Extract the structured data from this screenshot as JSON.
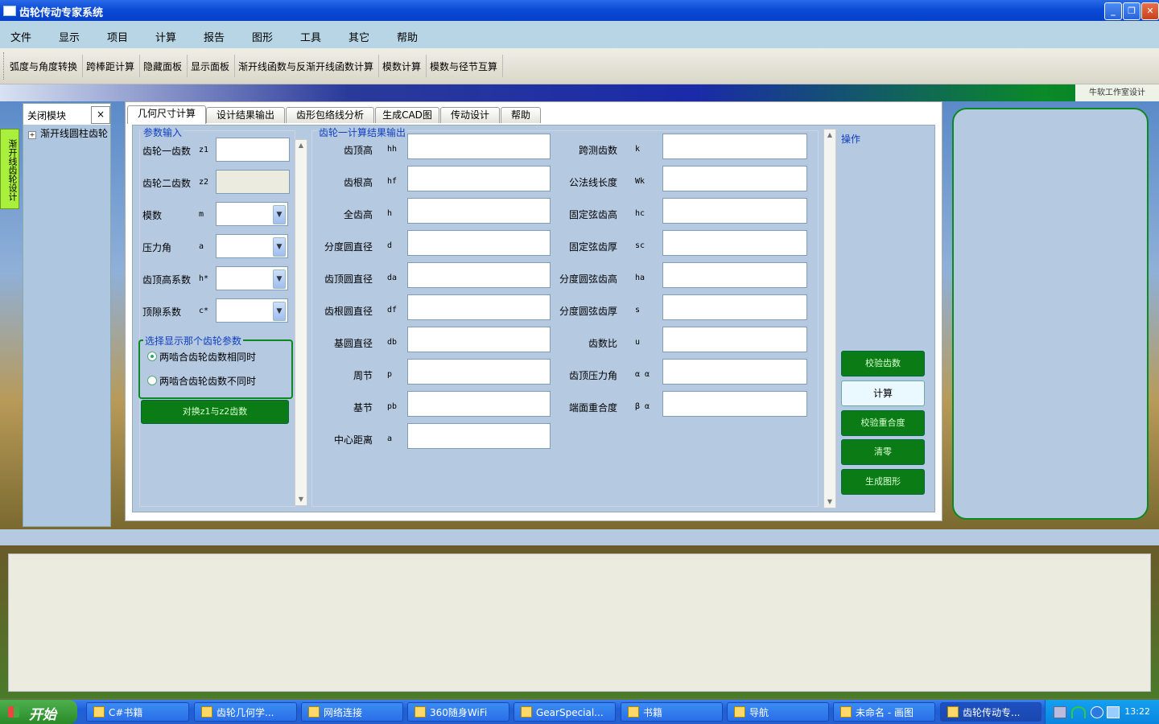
{
  "window": {
    "title": "齿轮传动专家系统",
    "buttons": {
      "minimize": "_",
      "maximize": "❐",
      "close": "✕"
    }
  },
  "menu": [
    "文件",
    "显示",
    "项目",
    "计算",
    "报告",
    "图形",
    "工具",
    "其它",
    "帮助"
  ],
  "toolbar": [
    "弧度与角度转换",
    "跨棒距计算",
    "隐藏面板",
    "显示面板",
    "渐开线函数与反渐开线函数计算",
    "模数计算",
    "模数与径节互算"
  ],
  "banner": {
    "credit": "牛软工作室设计"
  },
  "left_vtab": "渐开线齿轮设计",
  "side_panel": {
    "title": "关闭模块",
    "close": "×",
    "tree_items": [
      {
        "expander": "+",
        "label": "渐开线圆柱齿轮"
      }
    ]
  },
  "tabs": [
    "几何尺寸计算",
    "设计结果输出",
    "齿形包络线分析",
    "生成CAD图",
    "传动设计",
    "帮助"
  ],
  "param_panel": {
    "title": "参数输入",
    "fields": [
      {
        "label": "齿轮一齿数",
        "symbol": "z1",
        "type": "text",
        "value": ""
      },
      {
        "label": "齿轮二齿数",
        "symbol": "z2",
        "type": "disabled",
        "value": ""
      },
      {
        "label": "模数",
        "symbol": "m",
        "type": "combo",
        "value": ""
      },
      {
        "label": "压力角",
        "symbol": "a",
        "type": "combo",
        "value": ""
      },
      {
        "label": "齿顶高系数",
        "symbol": "h*",
        "type": "combo",
        "value": ""
      },
      {
        "label": "顶隙系数",
        "symbol": "c*",
        "type": "combo",
        "value": ""
      }
    ],
    "radio_group": {
      "title": "选择显示那个齿轮参数",
      "options": [
        {
          "label": "两啮合齿轮齿数相同时",
          "checked": true
        },
        {
          "label": "两啮合齿轮齿数不同时",
          "checked": false
        }
      ]
    },
    "swap_button": "对换z1与z2齿数"
  },
  "result_panel": {
    "title": "齿轮一计算结果输出",
    "left_fields": [
      {
        "label": "齿顶高",
        "symbol": "hh",
        "value": ""
      },
      {
        "label": "齿根高",
        "symbol": "hf",
        "value": ""
      },
      {
        "label": "全齿高",
        "symbol": "h",
        "value": ""
      },
      {
        "label": "分度圆直径",
        "symbol": "d",
        "value": ""
      },
      {
        "label": "齿顶圆直径",
        "symbol": "da",
        "value": ""
      },
      {
        "label": "齿根圆直径",
        "symbol": "df",
        "value": ""
      },
      {
        "label": "基圆直径",
        "symbol": "db",
        "value": ""
      },
      {
        "label": "周节",
        "symbol": "p",
        "value": ""
      },
      {
        "label": "基节",
        "symbol": "pb",
        "value": ""
      },
      {
        "label": "中心距离",
        "symbol": "a",
        "value": ""
      }
    ],
    "right_fields": [
      {
        "label": "跨测齿数",
        "symbol": "k",
        "value": ""
      },
      {
        "label": "公法线长度",
        "symbol": "Wk",
        "value": ""
      },
      {
        "label": "固定弦齿高",
        "symbol": "hc",
        "value": ""
      },
      {
        "label": "固定弦齿厚",
        "symbol": "sc",
        "value": ""
      },
      {
        "label": "分度圆弦齿高",
        "symbol": "ha",
        "value": ""
      },
      {
        "label": "分度圆弦齿厚",
        "symbol": "s",
        "value": ""
      },
      {
        "label": "齿数比",
        "symbol": "u",
        "value": ""
      },
      {
        "label": "齿顶压力角",
        "symbol": "α α",
        "value": ""
      },
      {
        "label": "端面重合度",
        "symbol": "β α",
        "value": ""
      }
    ]
  },
  "ops_panel": {
    "title": "操作",
    "buttons": [
      {
        "label": "校验齿数",
        "style": "green"
      },
      {
        "label": "计算",
        "style": "light"
      },
      {
        "label": "校验重合度",
        "style": "green"
      },
      {
        "label": "清零",
        "style": "green"
      },
      {
        "label": "生成图形",
        "style": "green"
      }
    ]
  },
  "scroll_arrows": {
    "up": "▲",
    "down": "▼",
    "combo": "▼"
  },
  "taskbar": {
    "start": "开始",
    "tasks": [
      "C#书籍",
      "齿轮几何学...",
      "网络连接",
      "360随身WiFi",
      "GearSpecial...",
      "书籍",
      "导航",
      "未命名 - 画图",
      "齿轮传动专..."
    ],
    "active_task": 8,
    "clock": "13:22"
  },
  "colors": {
    "accent_green": "#0b7b16",
    "panel_blue": "#b5c9e1",
    "title_blue": "#0a4bd6"
  }
}
